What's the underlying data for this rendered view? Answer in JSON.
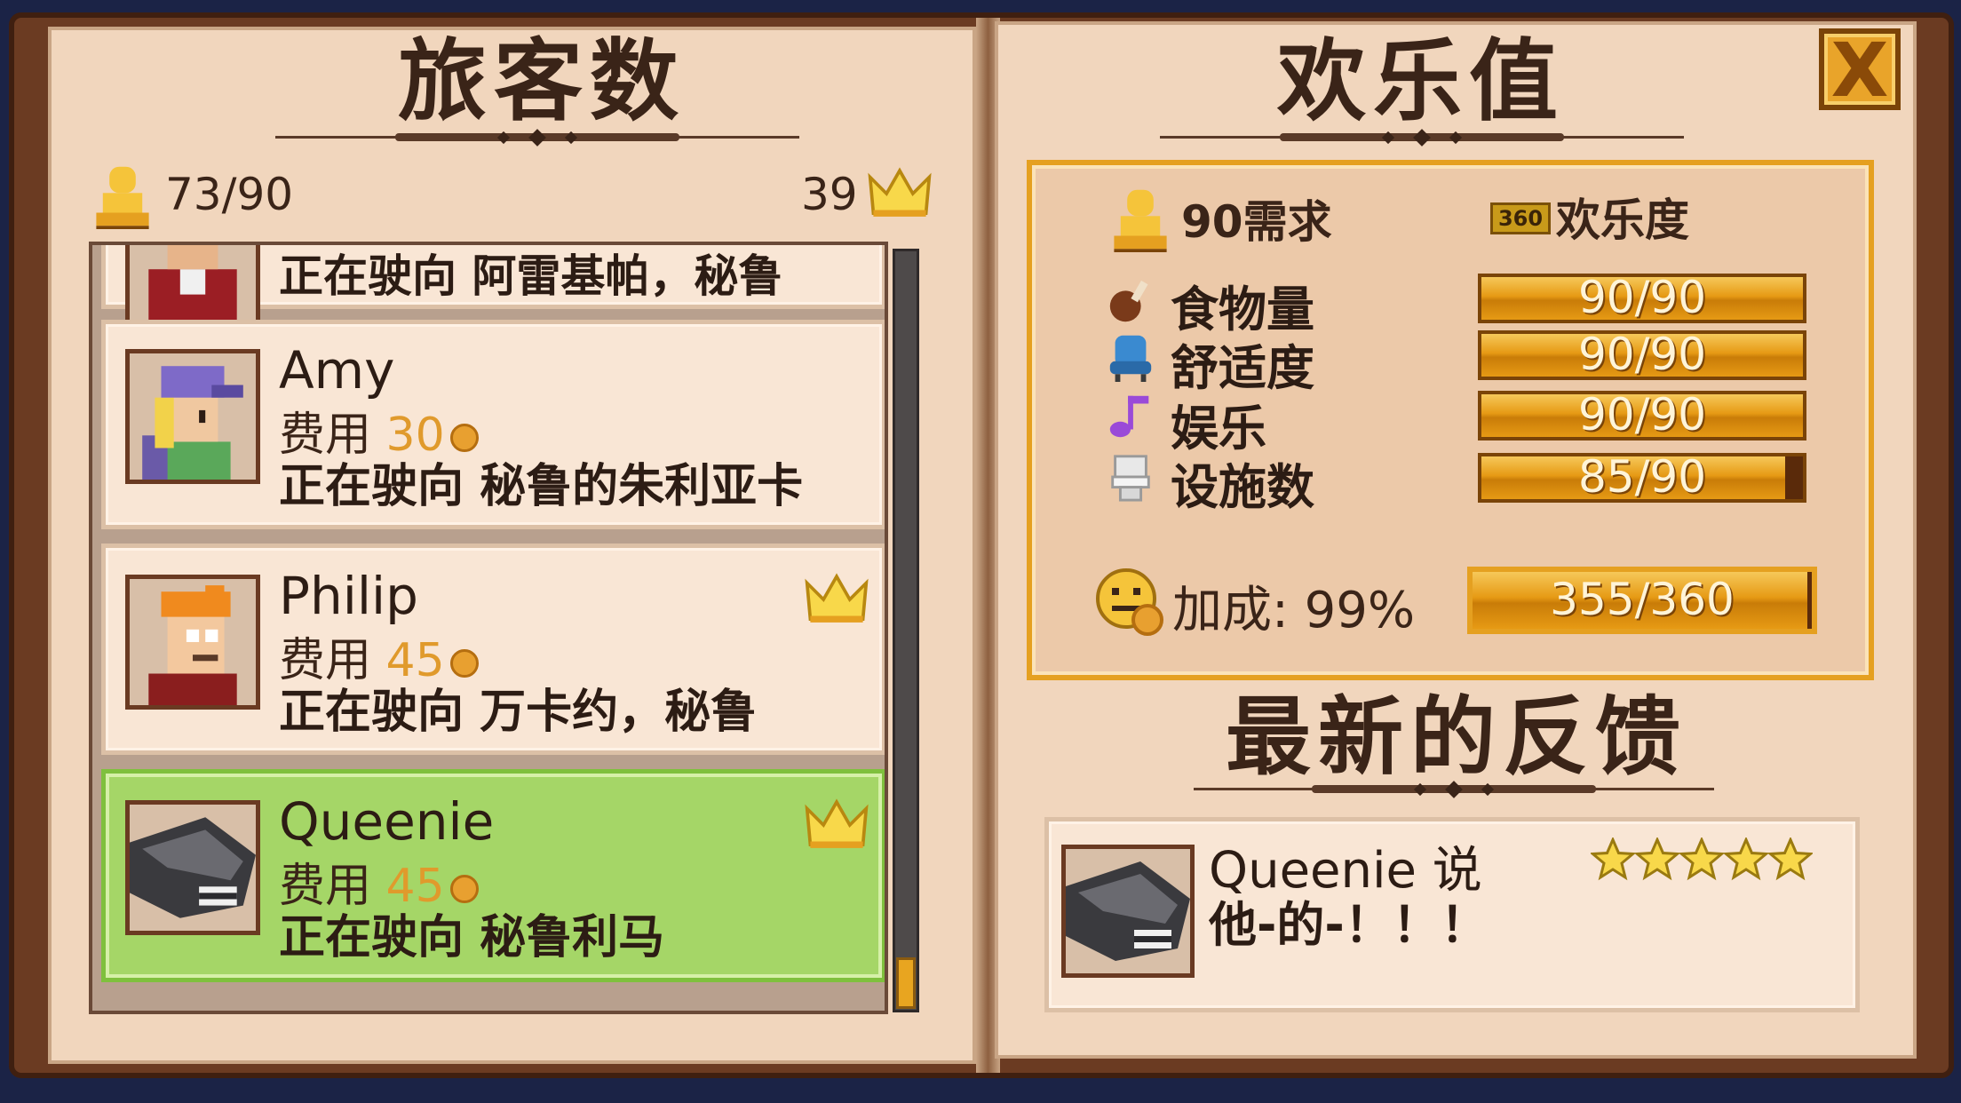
{
  "left_page": {
    "title": "旅客数",
    "passenger_count": "73/90",
    "vip_count": "39"
  },
  "passengers": [
    {
      "name": "",
      "fee_label": "",
      "fee": "",
      "destination": "正在驶向 阿雷基帕，秘鲁",
      "vip": false,
      "selected": false
    },
    {
      "name": "Amy",
      "fee_label": "费用",
      "fee": "30",
      "destination": "正在驶向 秘鲁的朱利亚卡",
      "vip": false,
      "selected": false
    },
    {
      "name": "Philip",
      "fee_label": "费用",
      "fee": "45",
      "destination": "正在驶向 万卡约，秘鲁",
      "vip": true,
      "selected": false
    },
    {
      "name": "Queenie",
      "fee_label": "费用",
      "fee": "45",
      "destination": "正在驶向 秘鲁利马",
      "vip": true,
      "selected": true
    }
  ],
  "right_page": {
    "title": "欢乐值",
    "demand": "90需求",
    "happiness_badge": "360",
    "happiness_label": "欢乐度",
    "metrics": [
      {
        "label": "食物量",
        "value": "90/90",
        "fraction": 1.0,
        "icon": "drumstick-icon"
      },
      {
        "label": "舒适度",
        "value": "90/90",
        "fraction": 1.0,
        "icon": "seat-icon"
      },
      {
        "label": "娱乐",
        "value": "90/90",
        "fraction": 1.0,
        "icon": "music-note-icon"
      },
      {
        "label": "设施数",
        "value": "85/90",
        "fraction": 0.944,
        "icon": "toilet-icon"
      }
    ],
    "bonus_label": "加成: 99%",
    "bonus_value": "355/360",
    "bonus_fraction": 0.986
  },
  "feedback": {
    "title": "最新的反馈",
    "speaker": "Queenie 说",
    "text": "他-的-！！！",
    "stars": 5
  },
  "close_label": "X",
  "colors": {
    "accent": "#e5a020",
    "selected": "#a5d667",
    "page": "#f1d6bd"
  }
}
